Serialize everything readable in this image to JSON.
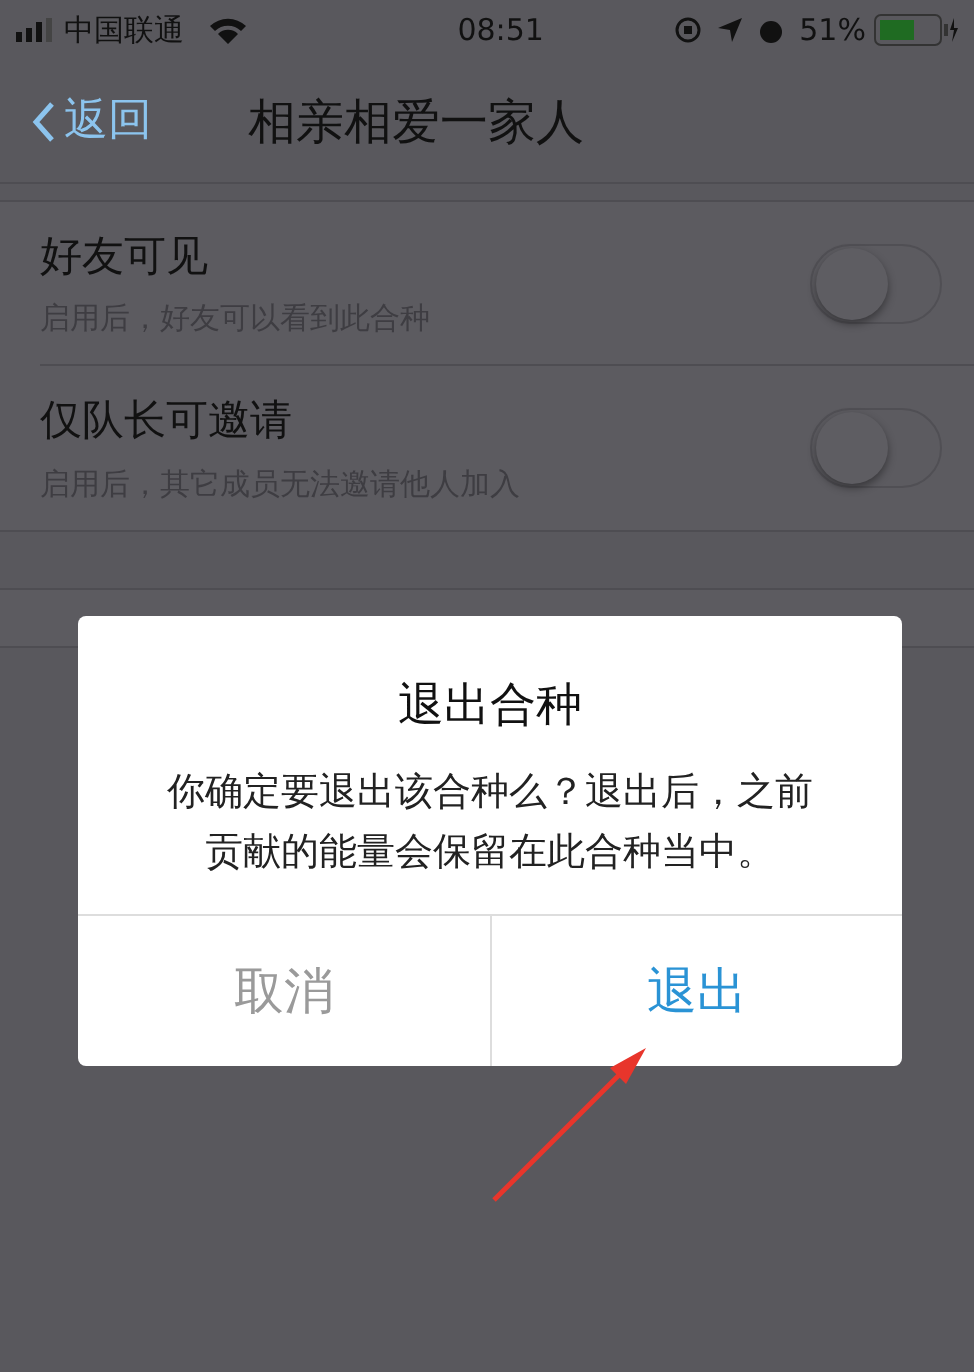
{
  "status_bar": {
    "carrier": "中国联通",
    "time": "08:51",
    "battery": "51%"
  },
  "nav": {
    "back": "返回",
    "title": "相亲相爱一家人"
  },
  "settings": [
    {
      "title": "好友可见",
      "description": "启用后，好友可以看到此合种",
      "on": false
    },
    {
      "title": "仅队长可邀请",
      "description": "启用后，其它成员无法邀请他人加入",
      "on": false
    }
  ],
  "dialog": {
    "title": "退出合种",
    "message": "你确定要退出该合种么？退出后，之前贡献的能量会保留在此合种当中。",
    "buttons": [
      {
        "label": "取消",
        "kind": "cancel"
      },
      {
        "label": "退出",
        "kind": "confirm"
      }
    ]
  }
}
